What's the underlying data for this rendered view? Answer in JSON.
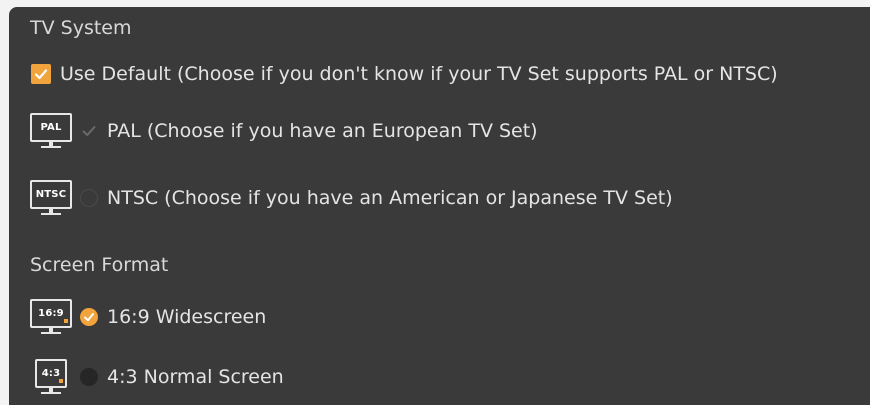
{
  "tv_system": {
    "title": "TV System",
    "use_default": {
      "label": "Use Default (Choose if you don't know if your TV Set supports PAL or NTSC)",
      "checked": true
    },
    "options": [
      {
        "icon_text": "PAL",
        "label": "PAL (Choose if you have an European TV Set)",
        "checked": true,
        "enabled": false
      },
      {
        "icon_text": "NTSC",
        "label": "NTSC (Choose if you have an American or Japanese TV Set)",
        "checked": false,
        "enabled": false
      }
    ]
  },
  "screen_format": {
    "title": "Screen Format",
    "options": [
      {
        "icon_text": "16:9",
        "label": "16:9 Widescreen",
        "checked": true
      },
      {
        "icon_text": "4:3",
        "label": "4:3 Normal Screen",
        "checked": false
      }
    ]
  },
  "colors": {
    "accent": "#f2a43c",
    "panel_bg": "#3a3a3a",
    "text": "#e4e4e4"
  }
}
